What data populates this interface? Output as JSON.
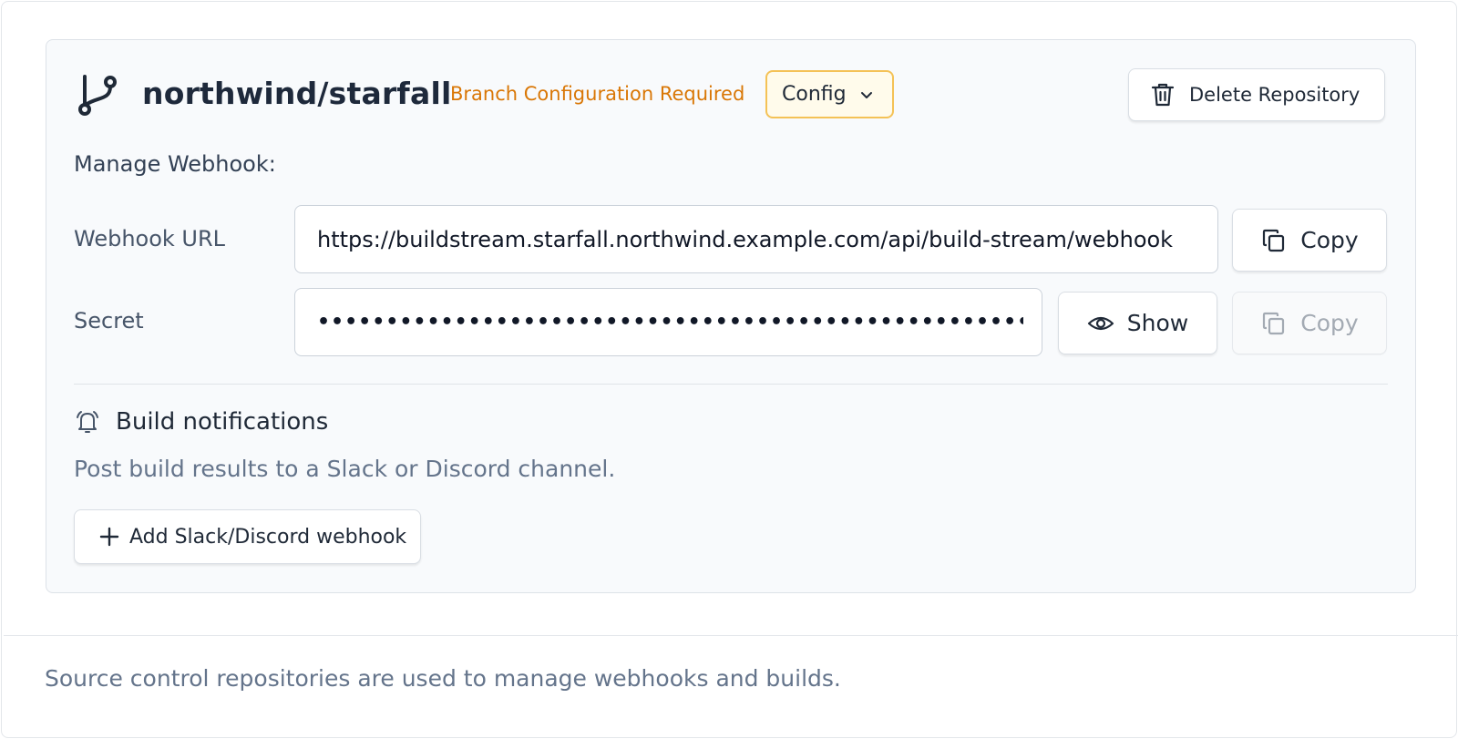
{
  "repository": {
    "name": "northwind/starfall",
    "status": "Branch Configuration Required",
    "config_label": "Config",
    "delete_label": "Delete Repository"
  },
  "webhook": {
    "section_label": "Manage Webhook:",
    "url_label": "Webhook URL",
    "url_value": "https://buildstream.starfall.northwind.example.com/api/build-stream/webhook",
    "copy_label": "Copy",
    "secret_label": "Secret",
    "secret_value": "••••••••••••••••••••••••••••••••••••••••••••••••••••••••••••••••",
    "show_label": "Show",
    "secret_copy_label": "Copy"
  },
  "notifications": {
    "title": "Build notifications",
    "description": "Post build results to a Slack or Discord channel.",
    "add_label": "Add Slack/Discord webhook"
  },
  "footer": {
    "text": "Source control repositories are used to manage webhooks and builds."
  },
  "colors": {
    "status": "#d97706",
    "config_border": "#f4c256",
    "card_bg": "#f8fafc"
  },
  "icons": {
    "repo": "git-branch-icon",
    "config": "chevron-down-icon",
    "delete": "trash-icon",
    "copy": "copy-icon",
    "show": "eye-icon",
    "notifications": "bell-icon",
    "add": "plus-icon"
  }
}
